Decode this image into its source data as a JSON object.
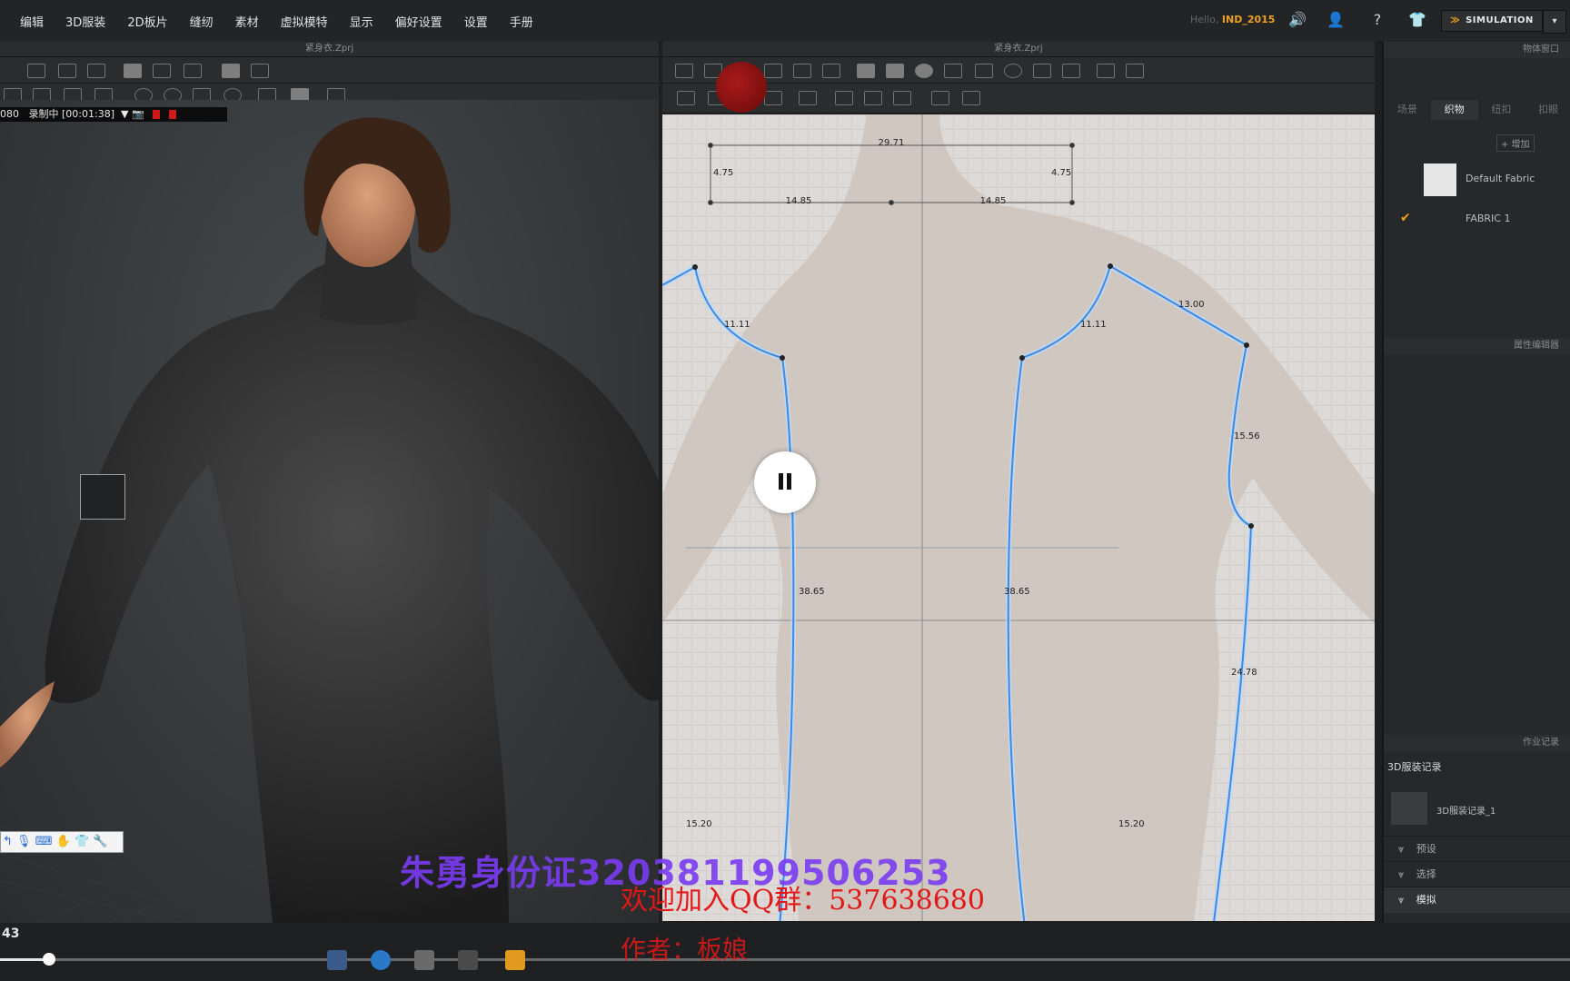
{
  "menu": {
    "items": [
      "编辑",
      "3D服装",
      "2D板片",
      "缝纫",
      "素材",
      "虚拟模特",
      "显示",
      "偏好设置",
      "设置",
      "手册"
    ],
    "hello_prefix": "Hello,",
    "username": "IND_2015",
    "simulation_label": "SIMULATION",
    "icons": [
      "speaker-icon",
      "user-icon",
      "help-icon",
      "tshirt-icon"
    ]
  },
  "panels": {
    "view3d_title": "紧身衣.Zprj",
    "view2d_title": "紧身衣.Zprj",
    "right_top_title": "物体窗口",
    "prop_editor_title": "属性编辑器",
    "history_title": "作业记录"
  },
  "recording": {
    "prefix": "080",
    "status": "录制中",
    "time": "[00:01:38]"
  },
  "object_browser": {
    "tabs": [
      "场景",
      "织物",
      "纽扣",
      "扣眼"
    ],
    "active_tab": 1,
    "add_button": "+ 增加",
    "fabrics": [
      {
        "name": "Default Fabric",
        "checked": false
      },
      {
        "name": "FABRIC 1",
        "checked": true
      }
    ]
  },
  "history": {
    "section_title": "3D服装记录",
    "entry": "3D服装记录_1",
    "rows": [
      "预设",
      "选择",
      "模拟"
    ]
  },
  "pattern_dims": {
    "collar_width": "29.71",
    "collar_left": "4.75",
    "collar_right": "4.75",
    "collar_half_left": "14.85",
    "collar_half_right": "14.85",
    "armhole_left": "11.11",
    "armhole_right": "11.11",
    "shoulder": "13.00",
    "upper_side": "15.56",
    "side_left": "38.65",
    "side_right": "38.65",
    "lower_side": "24.78",
    "hem_left": "15.20",
    "hem_right": "15.20"
  },
  "watermarks": {
    "id": "朱勇身份证320381199506253",
    "qq": "欢迎加入QQ群：537638680",
    "author": "作者：板娘"
  },
  "bottom": {
    "time_label": "43"
  },
  "colors": {
    "accent": "#f0a020",
    "pattern_line": "#3d8ae0",
    "watermark_red": "#e21818",
    "watermark_purple": "#7a3cf2"
  }
}
